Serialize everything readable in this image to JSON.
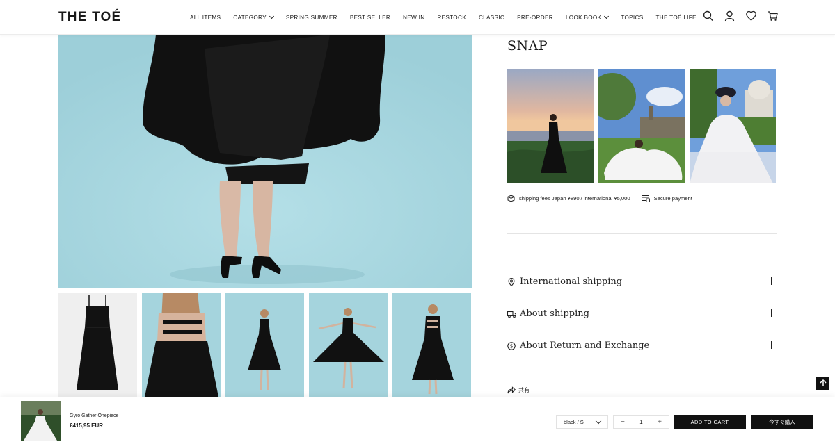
{
  "brand": {
    "logo": "THE TOÉ"
  },
  "nav": [
    {
      "label": "ALL ITEMS",
      "dropdown": false
    },
    {
      "label": "CATEGORY",
      "dropdown": true
    },
    {
      "label": "SPRING SUMMER",
      "dropdown": false
    },
    {
      "label": "BEST SELLER",
      "dropdown": false
    },
    {
      "label": "NEW IN",
      "dropdown": false
    },
    {
      "label": "RESTOCK",
      "dropdown": false
    },
    {
      "label": "CLASSIC",
      "dropdown": false
    },
    {
      "label": "PRE-ORDER",
      "dropdown": false
    },
    {
      "label": "LOOK BOOK",
      "dropdown": true
    },
    {
      "label": "TOPICS",
      "dropdown": false
    },
    {
      "label": "THE TOÉ LIFE",
      "dropdown": false
    }
  ],
  "header_icons": [
    "search-icon",
    "account-icon",
    "wishlist-heart-icon",
    "cart-icon"
  ],
  "snap": {
    "title": "SNAP"
  },
  "meta": {
    "shipping": "shipping fees Japan ¥890 / international ¥5,000",
    "payment": "Secure payment"
  },
  "accordion": [
    {
      "label": "International shipping",
      "icon": "location-pin-icon"
    },
    {
      "label": "About shipping",
      "icon": "truck-icon"
    },
    {
      "label": "About Return and Exchange",
      "icon": "dollar-circle-icon"
    }
  ],
  "share": {
    "label": "共有"
  },
  "sticky": {
    "product_name": "Gyro Gather Onepiece",
    "price": "€415,95 EUR",
    "variant": "black / S",
    "quantity": "1",
    "minus": "−",
    "plus": "+",
    "add_to_cart": "ADD TO CART",
    "buy_now": "今すぐ購入"
  },
  "colors": {
    "accent": "#111111",
    "hero_bg": "#a7d6df"
  }
}
